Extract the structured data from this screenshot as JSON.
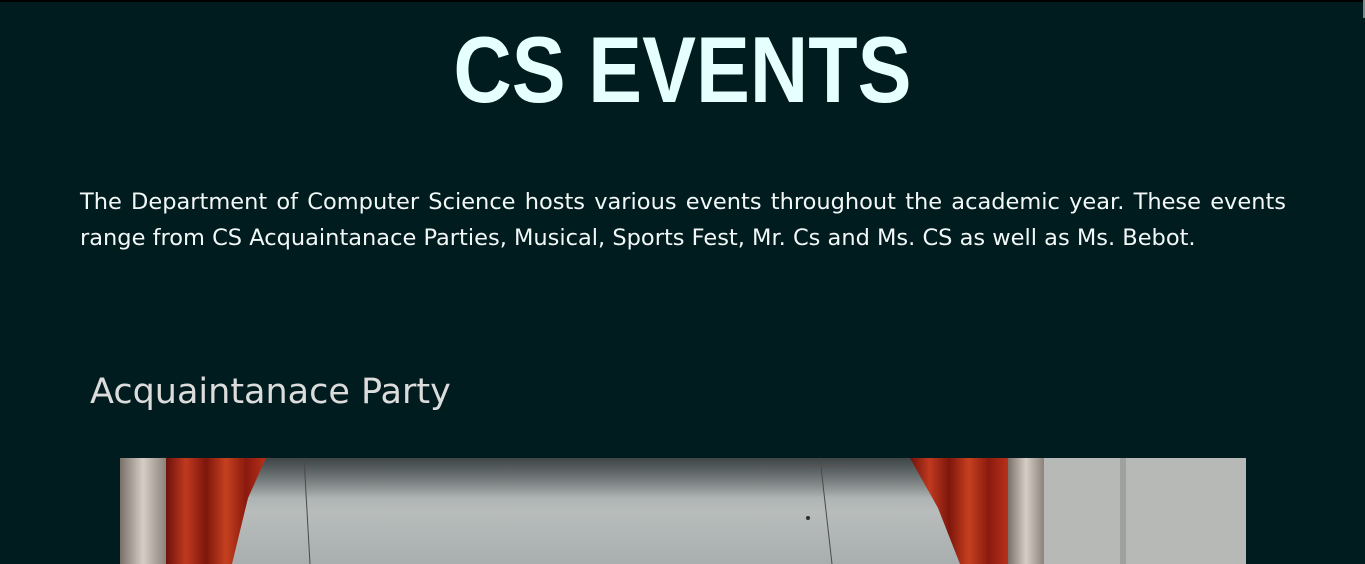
{
  "page": {
    "title": "CS EVENTS",
    "intro": "The Department of Computer Science hosts various events throughout the academic year. These events range from CS Acquaintanace Parties, Musical, Sports Fest, Mr. Cs and Ms. CS as well as Ms. Bebot."
  },
  "sections": [
    {
      "title": "Acquaintanace Party",
      "image": "stage-with-red-curtains-photo"
    }
  ],
  "colors": {
    "background": "#011c1e",
    "title": "#e6ffff",
    "text": "#f2f7f7",
    "section_title": "#dcdcdc",
    "curtain": "#b8301f"
  }
}
